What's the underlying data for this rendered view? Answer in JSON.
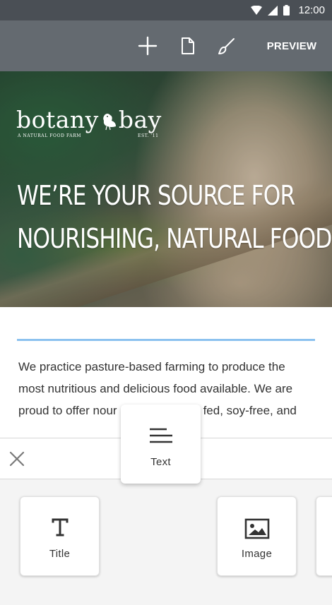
{
  "status_bar": {
    "time": "12:00"
  },
  "toolbar": {
    "add_icon": "plus-icon",
    "page_icon": "page-icon",
    "brush_icon": "brush-icon",
    "preview_label": "PREVIEW"
  },
  "hero": {
    "logo": {
      "wordmark_left": "botany",
      "wordmark_right": "bay",
      "tagline": "A NATURAL FOOD FARM",
      "est": "EST. '11"
    },
    "title_lines": [
      "WE’RE YOUR SOURCE FOR",
      "NOURISHING, NATURAL FOOD"
    ]
  },
  "content": {
    "accent_color": "#8cc2ef",
    "body_lines": [
      "We practice pasture-based farming to produce the",
      "most nutritious and delicious food available.  We are",
      "proud to offer nour",
      "fed, soy-free, and"
    ]
  },
  "panel": {
    "close_icon": "close-icon",
    "dragging_block": {
      "label": "Text",
      "icon": "text-align-icon"
    },
    "blocks": [
      {
        "label": "Title",
        "icon": "title-t-icon"
      },
      {
        "label": "Image",
        "icon": "image-icon"
      }
    ]
  }
}
